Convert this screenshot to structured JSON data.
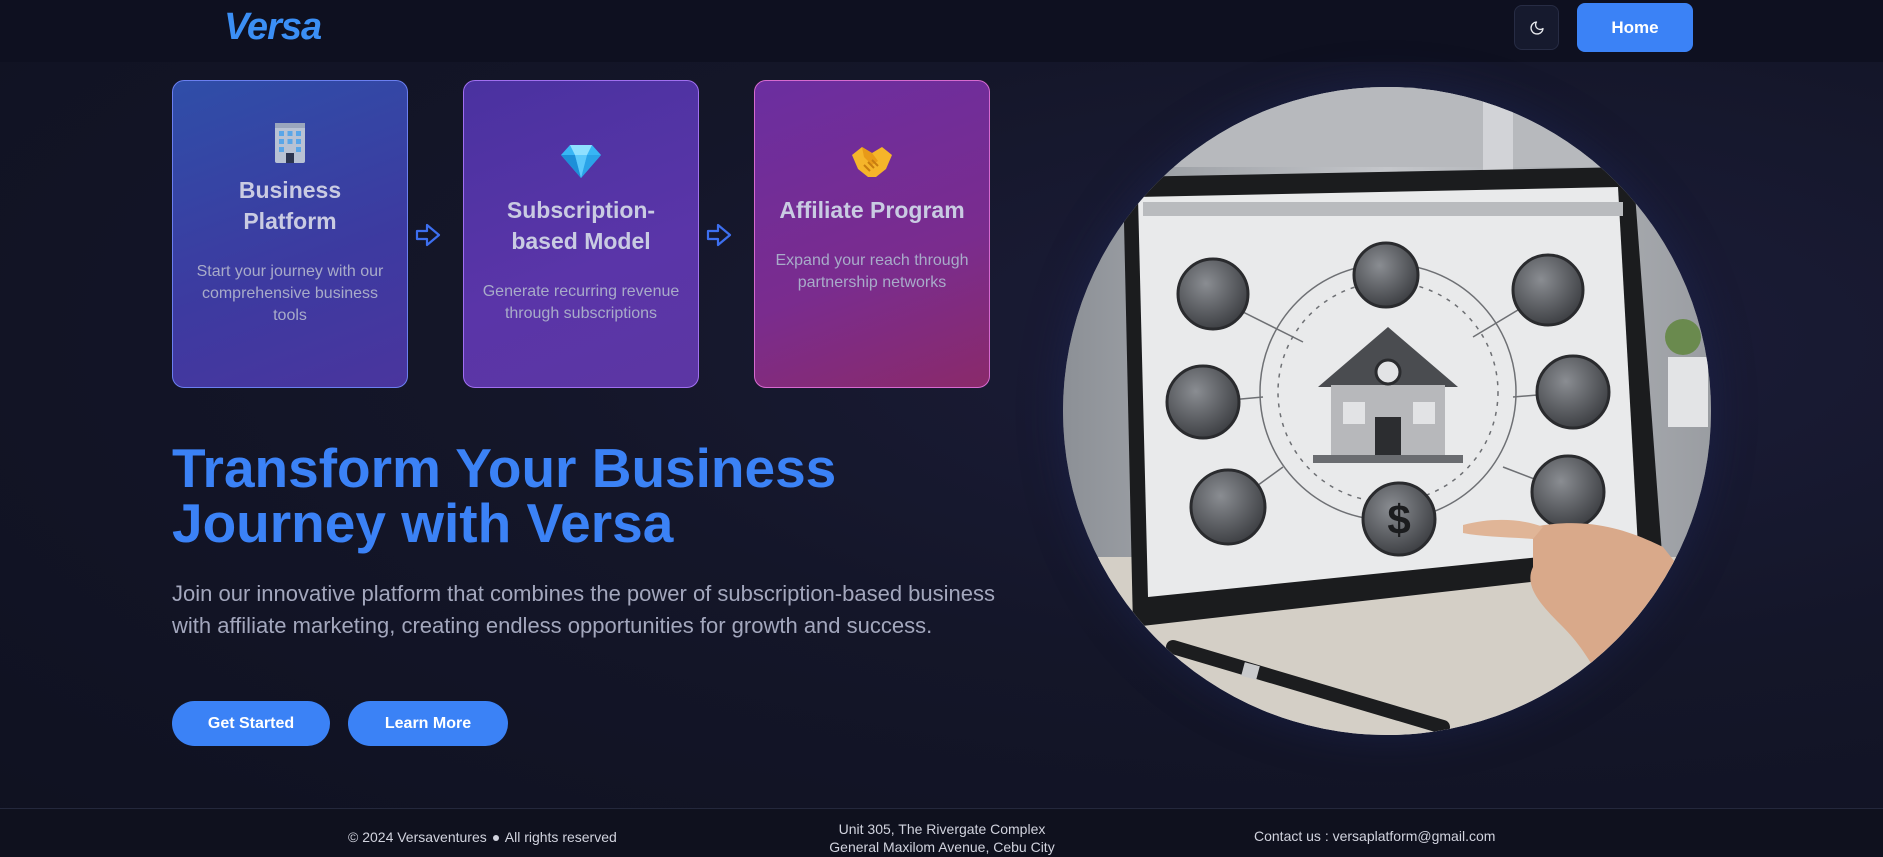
{
  "header": {
    "logo": "Versa",
    "theme_toggle_icon": "moon-icon",
    "home_label": "Home"
  },
  "cards": [
    {
      "icon": "office-building-icon",
      "title": "Business Platform",
      "description": "Start your journey with our comprehensive business tools"
    },
    {
      "icon": "diamond-icon",
      "title": "Subscription-based Model",
      "description": "Generate recurring revenue through subscriptions"
    },
    {
      "icon": "handshake-icon",
      "title": "Affiliate Program",
      "description": "Expand your reach through partnership networks"
    }
  ],
  "hero": {
    "title_line1": "Transform Your Business",
    "title_line2": "Journey with Versa",
    "description": "Join our innovative platform that combines the power of subscription-based business with affiliate marketing, creating endless opportunities for growth and success.",
    "get_started_label": "Get Started",
    "learn_more_label": "Learn More"
  },
  "footer": {
    "copyright": "© 2024 Versaventures",
    "rights": "All rights reserved",
    "address_line1": "Unit 305, The Rivergate Complex",
    "address_line2": "General Maxilom Avenue, Cebu City",
    "contact": "Contact us : versaplatform@gmail.com"
  },
  "colors": {
    "accent": "#3b82f6",
    "background": "#141629"
  }
}
